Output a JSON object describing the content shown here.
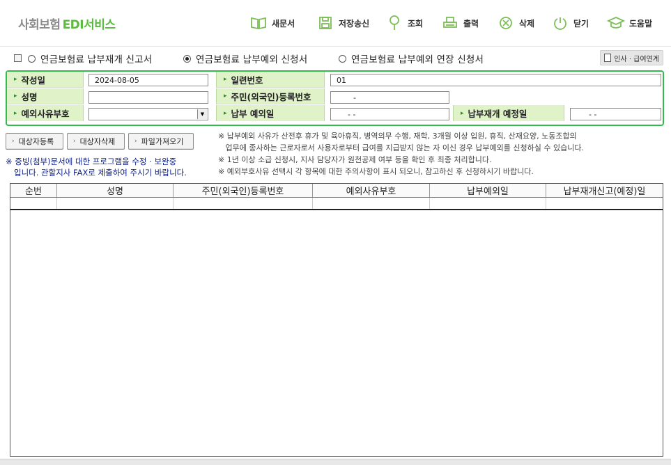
{
  "app": {
    "logo_text": "사회보험",
    "logo_accent": "EDI서비스"
  },
  "toolbar": {
    "new_doc": "새문서",
    "save_send": "저장송신",
    "search": "조회",
    "print": "출력",
    "delete": "삭제",
    "close": "닫기",
    "help": "도움말"
  },
  "radio_options": [
    {
      "label": "연금보험료 납부재개 신고서",
      "selected": false
    },
    {
      "label": "연금보험료 납부예외 신청서",
      "selected": true
    },
    {
      "label": "연금보험료 납부예외 연장 신청서",
      "selected": false
    }
  ],
  "hr_link_label": "인사 · 급여연계",
  "form": {
    "date_label": "작성일",
    "date_value": "2024-08-05",
    "serial_label": "일련번호",
    "serial_value": "01",
    "name_label": "성명",
    "name_value": "",
    "rrn_label": "주민(외국인)등록번호",
    "rrn_value": "-",
    "exception_code_label": "예외사유부호",
    "exception_code_value": "",
    "exception_date_label": "납부 예외일",
    "exception_date_value": "- -",
    "resume_date_label": "납부재개 예정일",
    "resume_date_value": "- -"
  },
  "buttons": {
    "register": "대상자등록",
    "remove": "대상자삭제",
    "import": "파일가져오기"
  },
  "note_left": {
    "line1": "※ 증빙(첨부)문서에 대한 프로그램을 수정 · 보완중",
    "line2": "입니다. 관할지사 FAX로 제출하여 주시기 바랍니다."
  },
  "notes": [
    "※ 납부예외 사유가 산전후 휴가 및 육아휴직, 병역의무 수행, 재학, 3개월 이상 입원, 휴직, 산재요양, 노동조합의",
    "   업무에 종사하는 근로자로서 사용자로부터 급여를 지급받지 않는 자 이신 경우 납부예외를 신청하실 수 있습니다.",
    "※ 1년 이상 소급 신청시, 지사 담당자가 원천공제 여부 등을 확인 후 최종 처리합니다.",
    "※ 예외부호사유 선택시 각 항목에 대한 주의사항이 표시 되오니, 참고하신 후 신청하시기 바랍니다."
  ],
  "table": {
    "columns": [
      "순번",
      "성명",
      "주민(외국인)등록번호",
      "예외사유부호",
      "납부예외일",
      "납부재개신고(예정)일"
    ],
    "rows": [
      [
        "",
        "",
        "",
        "",
        "",
        ""
      ]
    ]
  },
  "colors": {
    "accent_green": "#36b94c",
    "label_bg": "#dff2c8",
    "note_blue": "#0b1f8a"
  }
}
